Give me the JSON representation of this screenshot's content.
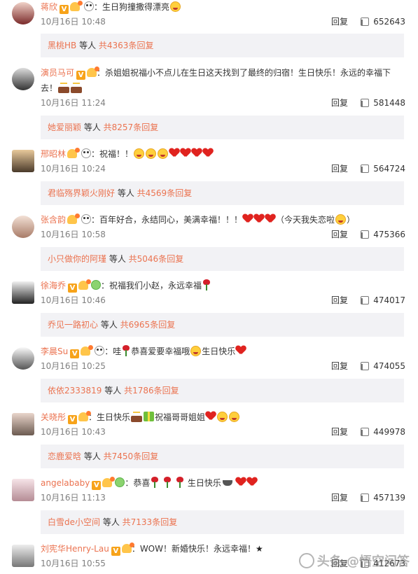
{
  "comments": [
    {
      "name": "蒋欣",
      "text": "：生日狗撞撒得漂亮",
      "time": "10月16日 10:48",
      "reply": "回复",
      "likes": "652643",
      "replybox": {
        "name": "黑桃HB",
        "mid": " 等人 ",
        "count": "共4363条回复"
      }
    },
    {
      "name": "演员马可",
      "text": "：杀姐姐祝福小不点儿在生日这天找到了最终的归宿！生日快乐！永远的幸福下去！",
      "time": "10月16日 11:24",
      "reply": "回复",
      "likes": "581448",
      "replybox": {
        "name": "她爱丽颖",
        "mid": " 等人 ",
        "count": "共8257条回复"
      }
    },
    {
      "name": "邢昭林",
      "text": "：祝福！！",
      "time": "10月16日 10:24",
      "reply": "回复",
      "likes": "564724",
      "replybox": {
        "name": "君临殇界颖火刚好",
        "mid": " 等人 ",
        "count": "共4569条回复"
      }
    },
    {
      "name": "张含韵",
      "text": "：百年好合，永结同心，美满幸福！！！",
      "text2": "（今天我失恋啦",
      "text3": "）",
      "time": "10月16日 10:58",
      "reply": "回复",
      "likes": "475366",
      "replybox": {
        "name": "小只做你的阿瑾",
        "mid": " 等人 ",
        "count": "共5046条回复"
      }
    },
    {
      "name": "徐海乔",
      "text": "：祝福我们小赵，永远幸福",
      "time": "10月16日 10:46",
      "reply": "回复",
      "likes": "474017",
      "replybox": {
        "name": "乔见一路初心",
        "mid": " 等人 ",
        "count": "共6965条回复"
      }
    },
    {
      "name": "李晨Su",
      "text": "：哇",
      "text2": "恭喜爱要幸福哦",
      "text3": "生日快乐",
      "time": "10月16日 10:25",
      "reply": "回复",
      "likes": "474055",
      "replybox": {
        "name": "依依2333819",
        "mid": " 等人 ",
        "count": "共1786条回复"
      }
    },
    {
      "name": "关晓彤",
      "text": "：生日快乐",
      "text2": "祝福哥哥姐姐",
      "time": "10月16日 10:43",
      "reply": "回复",
      "likes": "449978",
      "replybox": {
        "name": "恋鹿爱晗",
        "mid": " 等人 ",
        "count": "共7450条回复"
      }
    },
    {
      "name": "angelababy",
      "text": "：恭喜",
      "text2": "生日快乐",
      "time": "10月16日 11:13",
      "reply": "回复",
      "likes": "457139",
      "replybox": {
        "name": "白雪de小空间",
        "mid": " 等人 ",
        "count": "共7133条回复"
      }
    },
    {
      "name": "刘宪华Henry-Lau",
      "text": "：WOW！新婚快乐！永远幸福！",
      "time": "10月16日 10:55",
      "reply": "回复",
      "likes": "412673"
    }
  ],
  "badges": {
    "v": "V"
  },
  "watermark": "头条 @悟空问答",
  "colors": {
    "name": "#eb7350",
    "box": "#f2f2f5",
    "heart": "#e0231f"
  }
}
